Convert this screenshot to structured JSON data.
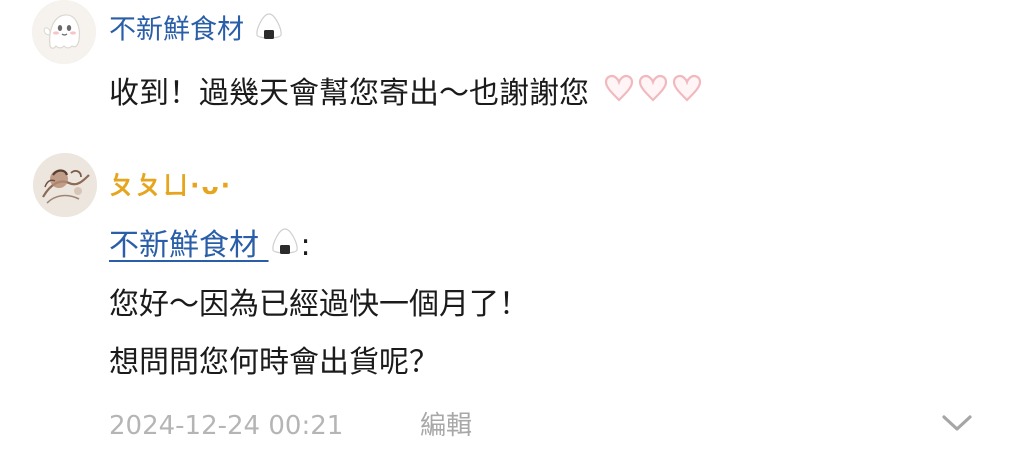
{
  "comments": [
    {
      "username": "不新鮮食材",
      "username_icon": "onigiri-icon",
      "avatar": "ghost-avatar",
      "text": "收到！過幾天會幫您寄出～也謝謝您",
      "trailing_icons": [
        "heart-outline-icon",
        "heart-outline-icon",
        "heart-outline-icon"
      ]
    },
    {
      "username": "ㄆㄆㄩ·ᴗ·",
      "avatar": "illustration-avatar",
      "mention": "不新鮮食材",
      "mention_icon": "onigiri-icon",
      "mention_suffix": ":",
      "lines": [
        "您好～因為已經過快一個月了！",
        "想問問您何時會出貨呢？"
      ],
      "timestamp": "2024-12-24 00:21",
      "edit_label": "編輯"
    }
  ],
  "icons": {
    "expand": "chevron-down-icon"
  },
  "colors": {
    "link_blue": "#2a5ea8",
    "username_orange": "#e6a51e",
    "meta_gray": "#b5b5b5",
    "heart_pink": "#f1b9be"
  }
}
